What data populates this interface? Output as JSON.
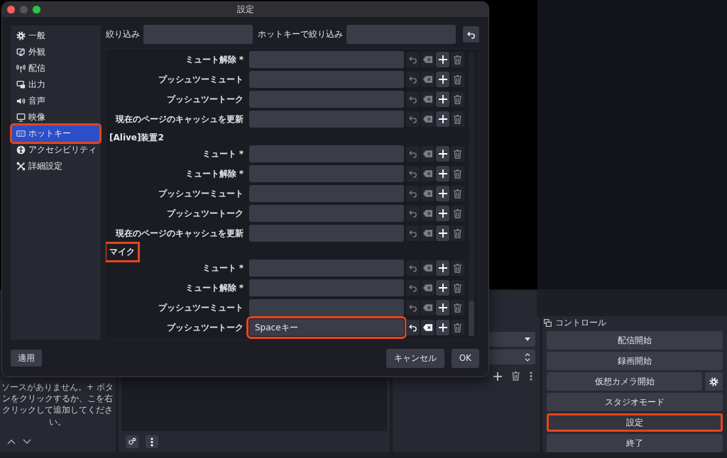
{
  "window": {
    "title": "設定"
  },
  "sidebar": {
    "items": [
      {
        "label": "一般",
        "selected": false,
        "highlighted": false
      },
      {
        "label": "外観",
        "selected": false,
        "highlighted": false
      },
      {
        "label": "配信",
        "selected": false,
        "highlighted": false
      },
      {
        "label": "出力",
        "selected": false,
        "highlighted": false
      },
      {
        "label": "音声",
        "selected": false,
        "highlighted": false
      },
      {
        "label": "映像",
        "selected": false,
        "highlighted": false
      },
      {
        "label": "ホットキー",
        "selected": true,
        "highlighted": true
      },
      {
        "label": "アクセシビリティ",
        "selected": false,
        "highlighted": false
      },
      {
        "label": "詳細設定",
        "selected": false,
        "highlighted": false
      }
    ]
  },
  "filters": [
    {
      "label": "絞り込み"
    },
    {
      "label": "ホットキーで絞り込み"
    }
  ],
  "sections": [
    {
      "rows": [
        {
          "label": "ミュート解除 *",
          "highlighted": false,
          "actions_enabled": false
        },
        {
          "label": "プッシュツーミュート",
          "highlighted": false,
          "actions_enabled": false
        },
        {
          "label": "プッシュツートーク",
          "highlighted": false,
          "actions_enabled": false
        },
        {
          "label": "現在のページのキャッシュを更新",
          "highlighted": false,
          "actions_enabled": false
        }
      ]
    },
    {
      "title": "[Alive]装置2",
      "highlighted": false,
      "rows": [
        {
          "label": "ミュート *",
          "highlighted": false,
          "actions_enabled": false
        },
        {
          "label": "ミュート解除 *",
          "highlighted": false,
          "actions_enabled": false
        },
        {
          "label": "プッシュツーミュート",
          "highlighted": false,
          "actions_enabled": false
        },
        {
          "label": "プッシュツートーク",
          "highlighted": false,
          "actions_enabled": false
        },
        {
          "label": "現在のページのキャッシュを更新",
          "highlighted": false,
          "actions_enabled": false
        }
      ]
    },
    {
      "title": "マイク",
      "highlighted": true,
      "rows": [
        {
          "label": "ミュート *",
          "highlighted": false,
          "actions_enabled": false
        },
        {
          "label": "ミュート解除 *",
          "highlighted": false,
          "actions_enabled": false
        },
        {
          "label": "プッシュツーミュート",
          "highlighted": false,
          "actions_enabled": false
        },
        {
          "label": "プッシュツートーク",
          "value": "Spaceキー",
          "highlighted": true,
          "actions_enabled": true
        }
      ]
    }
  ],
  "apply_button": "適用",
  "footer_buttons": [
    "キャンセル",
    "OK"
  ],
  "sources_dock": {
    "empty_message": "ソースがありません。+ ボタンをクリックするか、こを右クリックして追加してください。"
  },
  "controls_dock": {
    "title": "コントロール",
    "buttons": [
      {
        "label": "配信開始",
        "highlighted": false,
        "has_settings": false
      },
      {
        "label": "録画開始",
        "highlighted": false,
        "has_settings": false
      },
      {
        "label": "仮想カメラ開始",
        "highlighted": false,
        "has_settings": true
      },
      {
        "label": "スタジオモード",
        "highlighted": false,
        "has_settings": false
      },
      {
        "label": "設定",
        "highlighted": true,
        "has_settings": false
      },
      {
        "label": "終了",
        "highlighted": false,
        "has_settings": false
      }
    ]
  }
}
